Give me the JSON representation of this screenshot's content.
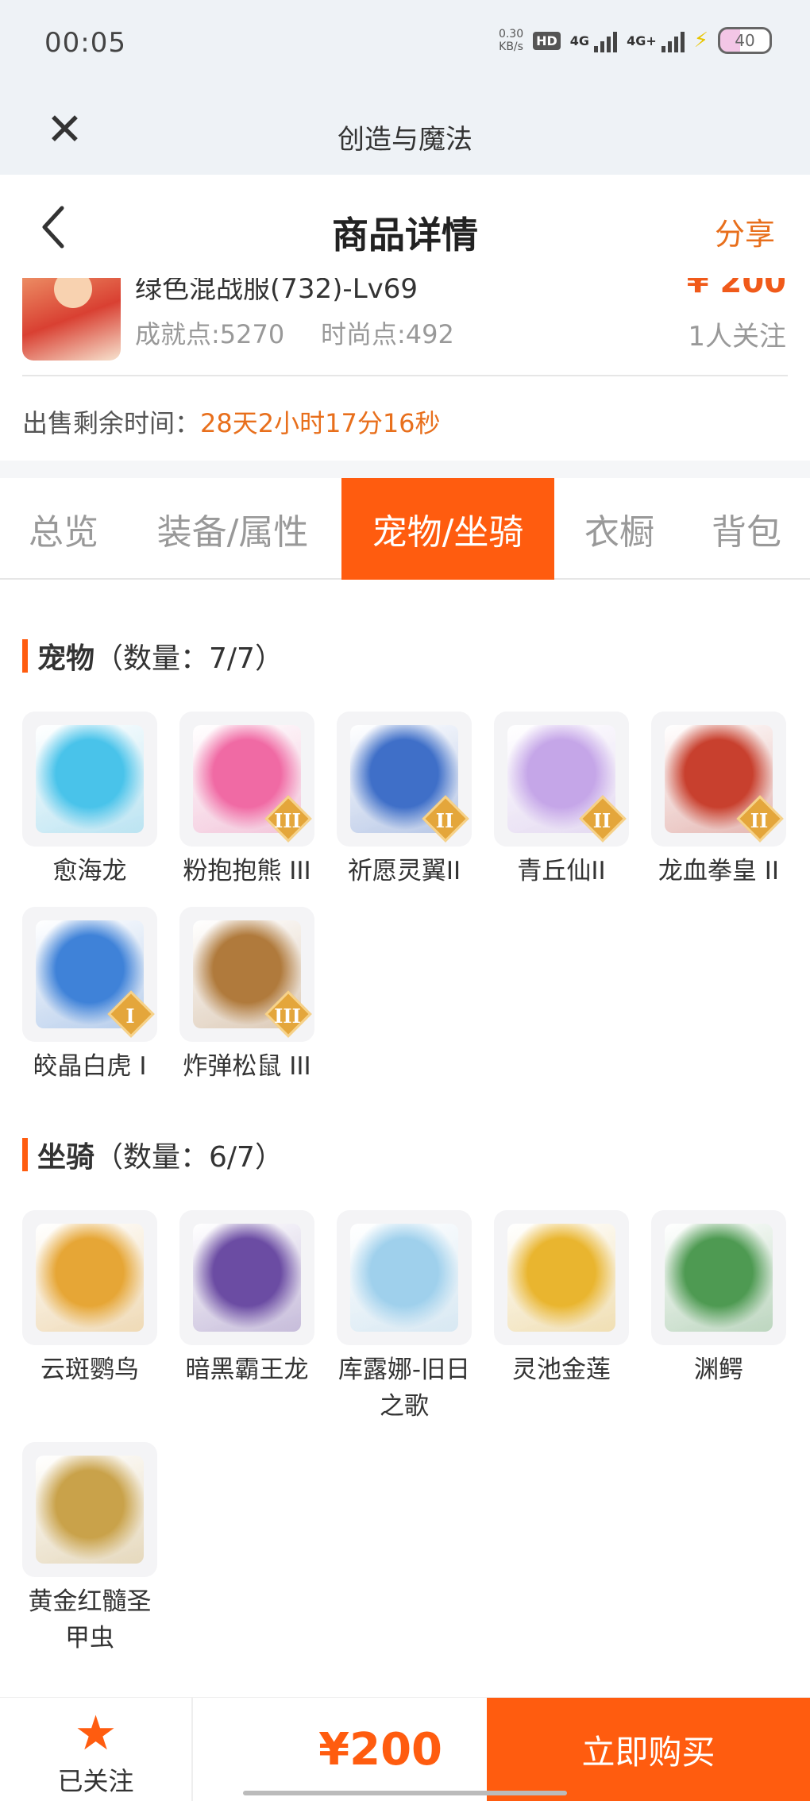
{
  "status": {
    "time": "00:05",
    "speed": "0.30",
    "speed_unit": "KB/s",
    "hd": "HD",
    "net1": "4G",
    "net2": "4G+",
    "battery": "40"
  },
  "webview": {
    "title": "创造与魔法"
  },
  "nav": {
    "title": "商品详情",
    "share": "分享"
  },
  "product": {
    "name": "绿色混战服(732)-Lv69",
    "price": "¥ 200",
    "achievement": "成就点:5270",
    "fashion": "时尚点:492",
    "followers": "1人关注",
    "remain_label": "出售剩余时间：",
    "remain_value": "28天2小时17分16秒"
  },
  "tabs": [
    {
      "label": "总览"
    },
    {
      "label": "装备/属性"
    },
    {
      "label": "宠物/坐骑"
    },
    {
      "label": "衣橱"
    },
    {
      "label": "背包"
    }
  ],
  "active_tab": 2,
  "pets": {
    "title": "宠物",
    "count": "（数量：7/7）",
    "items": [
      {
        "name": "愈海龙",
        "rank": "",
        "color": "#49c3ea"
      },
      {
        "name": "粉抱抱熊 III",
        "rank": "III",
        "color": "#f06aa4"
      },
      {
        "name": "祈愿灵翼II",
        "rank": "II",
        "color": "#3f6fc8"
      },
      {
        "name": "青丘仙II",
        "rank": "II",
        "color": "#c5a6e8"
      },
      {
        "name": "龙血拳皇 II",
        "rank": "II",
        "color": "#c8402e"
      },
      {
        "name": "皎晶白虎 I",
        "rank": "I",
        "color": "#3f82d8"
      },
      {
        "name": "炸弹松鼠 III",
        "rank": "III",
        "color": "#b07a3c"
      }
    ]
  },
  "mounts": {
    "title": "坐骑",
    "count": "（数量：6/7）",
    "items": [
      {
        "name": "云斑鹦鸟",
        "color": "#e6a636"
      },
      {
        "name": "暗黑霸王龙",
        "color": "#6b4ca3"
      },
      {
        "name": "库露娜-旧日之歌",
        "color": "#9fd0ec"
      },
      {
        "name": "灵池金莲",
        "color": "#e9b52f"
      },
      {
        "name": "渊鳄",
        "color": "#4e9a52"
      },
      {
        "name": "黄金红髓圣甲虫",
        "color": "#c9a24a"
      }
    ]
  },
  "bottom": {
    "follow_label": "已关注",
    "price": "¥200",
    "buy_label": "立即购买"
  }
}
